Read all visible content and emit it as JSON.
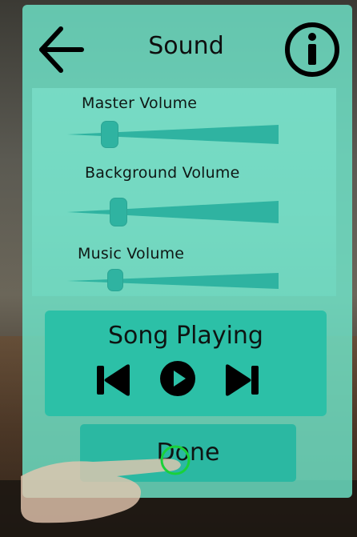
{
  "header": {
    "title": "Sound"
  },
  "sliders": [
    {
      "label": "Master Volume",
      "value": 0.16
    },
    {
      "label": "Background Volume",
      "value": 0.2
    },
    {
      "label": "Music Volume",
      "value": 0.19
    }
  ],
  "player": {
    "title": "Song Playing",
    "controls": [
      "skip-previous-icon",
      "play-icon",
      "skip-next-icon"
    ]
  },
  "footer": {
    "done_label": "Done"
  },
  "colors": {
    "panel": "#6fe8cd",
    "accent": "#2cc0a7",
    "knob": "#2fb3a1",
    "text": "#0e0e0e"
  }
}
